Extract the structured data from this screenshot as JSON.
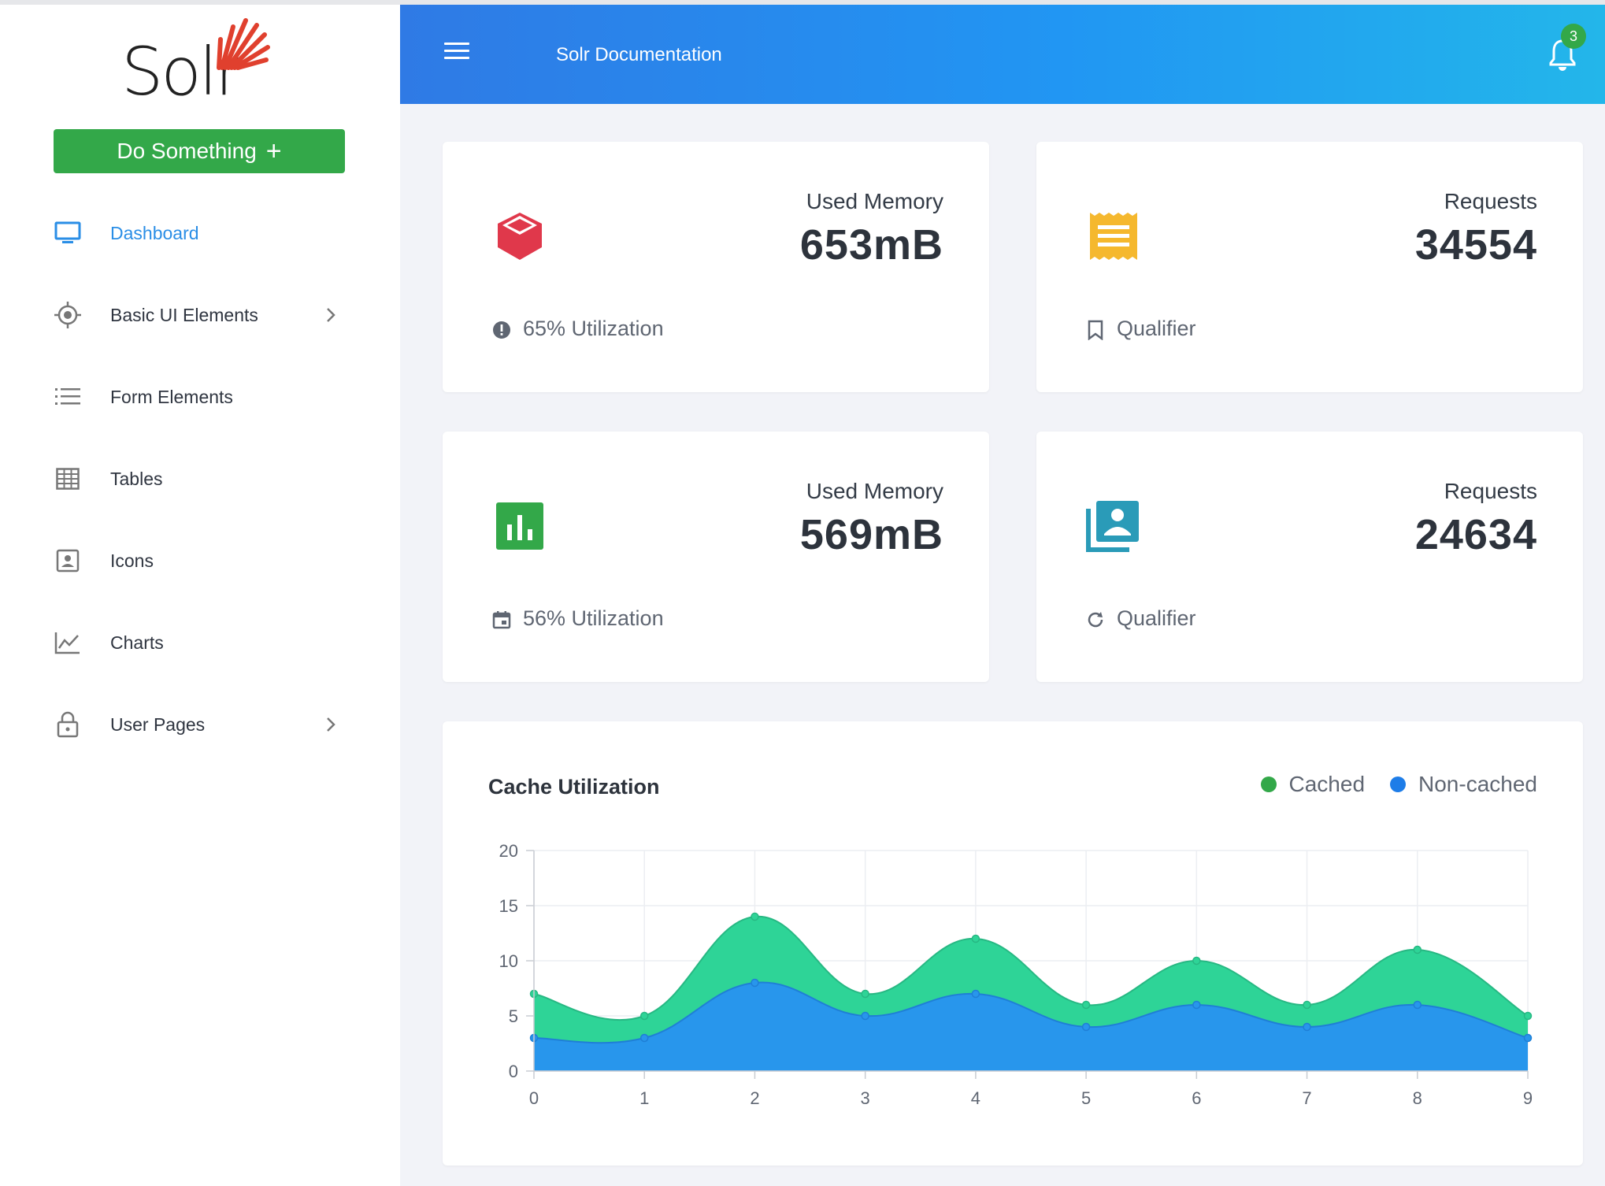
{
  "brand": {
    "logo_text": "Solr"
  },
  "sidebar": {
    "action_button": {
      "label": "Do Something",
      "icon": "plus-icon"
    },
    "items": [
      {
        "label": "Dashboard",
        "icon": "monitor-icon",
        "active": true,
        "has_children": false
      },
      {
        "label": "Basic UI Elements",
        "icon": "crosshair-icon",
        "active": false,
        "has_children": true
      },
      {
        "label": "Form Elements",
        "icon": "list-icon",
        "active": false,
        "has_children": false
      },
      {
        "label": "Tables",
        "icon": "table-grid-icon",
        "active": false,
        "has_children": false
      },
      {
        "label": "Icons",
        "icon": "portrait-icon",
        "active": false,
        "has_children": false
      },
      {
        "label": "Charts",
        "icon": "line-chart-icon",
        "active": false,
        "has_children": false
      },
      {
        "label": "User Pages",
        "icon": "lock-icon",
        "active": false,
        "has_children": true
      }
    ]
  },
  "header": {
    "title": "Solr Documentation",
    "notifications": {
      "count": "3",
      "icon": "bell-icon"
    }
  },
  "stats": [
    {
      "label": "Used Memory",
      "value": "653mB",
      "footer": "65% Utilization",
      "icon": "cube-icon",
      "icon_color": "#e0384b",
      "footer_icon": "alert-circle-icon"
    },
    {
      "label": "Requests",
      "value": "34554",
      "footer": "Qualifier",
      "icon": "receipt-icon",
      "icon_color": "#f5b82e",
      "footer_icon": "bookmark-icon"
    },
    {
      "label": "Used Memory",
      "value": "569mB",
      "footer": "56% Utilization",
      "icon": "bar-chart-icon",
      "icon_color": "#33a849",
      "footer_icon": "calendar-icon"
    },
    {
      "label": "Requests",
      "value": "24634",
      "footer": "Qualifier",
      "icon": "contacts-icon",
      "icon_color": "#2a9bb8",
      "footer_icon": "refresh-icon"
    }
  ],
  "colors": {
    "accent_green": "#33a849",
    "accent_blue": "#2a8ee6",
    "cached": "#2ed497",
    "non_cached": "#2896ec"
  },
  "chart_data": {
    "type": "area",
    "title": "Cache Utilization",
    "x": [
      0,
      1,
      2,
      3,
      4,
      5,
      6,
      7,
      8,
      9
    ],
    "series": [
      {
        "name": "Cached",
        "values": [
          7,
          5,
          14,
          7,
          12,
          6,
          10,
          6,
          11,
          5
        ],
        "color": "#2ed497",
        "legend_color": "#33a849"
      },
      {
        "name": "Non-cached",
        "values": [
          3,
          3,
          8,
          5,
          7,
          4,
          6,
          4,
          6,
          3
        ],
        "color": "#2896ec",
        "legend_color": "#1e7de8"
      }
    ],
    "y_ticks": [
      0,
      5,
      10,
      15,
      20
    ],
    "ylim": [
      0,
      20
    ],
    "xlim": [
      0,
      9
    ],
    "grid": true,
    "legend_position": "top-right"
  }
}
